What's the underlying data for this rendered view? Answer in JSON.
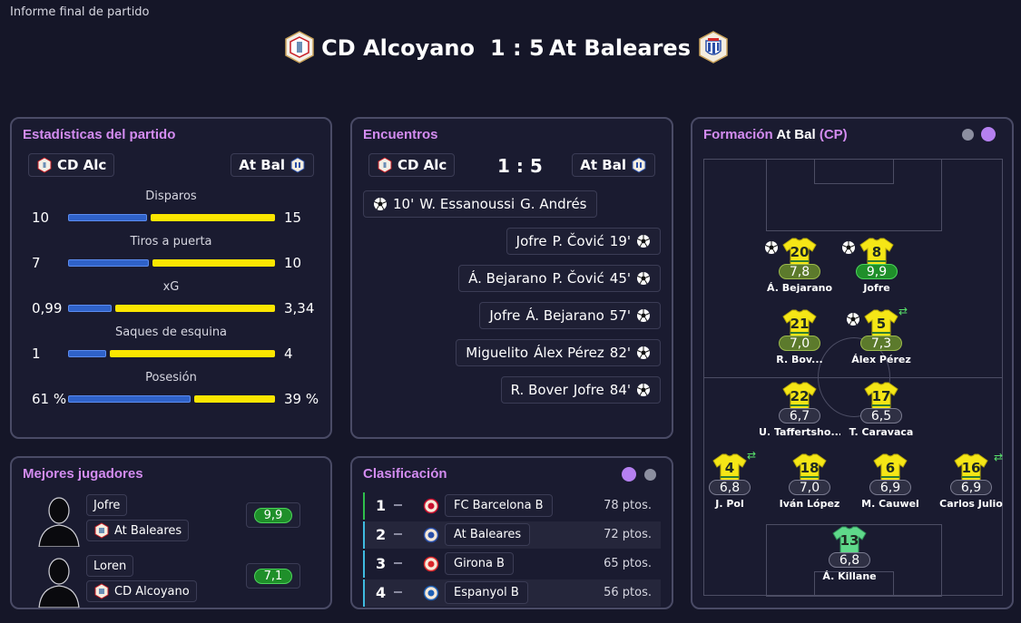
{
  "window": {
    "title": "Informe final de partido"
  },
  "match": {
    "home": "CD Alcoyano",
    "away": "At Baleares",
    "score": "1 : 5",
    "home_short": "CD Alc",
    "away_short": "At Bal"
  },
  "stats_panel": {
    "title": "Estadísticas del partido",
    "rows": [
      {
        "label": "Disparos",
        "home": "10",
        "away": "15",
        "home_frac": 0.4,
        "away_frac": 0.6
      },
      {
        "label": "Tiros a puerta",
        "home": "7",
        "away": "10",
        "home_frac": 0.41,
        "away_frac": 0.59
      },
      {
        "label": "xG",
        "home": "0,99",
        "away": "3,34",
        "home_frac": 0.23,
        "away_frac": 0.77
      },
      {
        "label": "Saques de esquina",
        "home": "1",
        "away": "4",
        "home_frac": 0.2,
        "away_frac": 0.8
      },
      {
        "label": "Posesión",
        "home": "61 %",
        "away": "39 %",
        "home_frac": 0.61,
        "away_frac": 0.39
      }
    ]
  },
  "events_panel": {
    "title": "Encuentros",
    "score": "1 : 5",
    "events": [
      {
        "side": "home",
        "minute": "10'",
        "scorer": "W. Essanoussi",
        "assist": "G. Andrés"
      },
      {
        "side": "away",
        "minute": "19'",
        "scorer": "P. Čović",
        "assist": "Jofre"
      },
      {
        "side": "away",
        "minute": "45'",
        "scorer": "P. Čović",
        "assist": "Á. Bejarano"
      },
      {
        "side": "away",
        "minute": "57'",
        "scorer": "Á. Bejarano",
        "assist": "Jofre"
      },
      {
        "side": "away",
        "minute": "82'",
        "scorer": "Álex Pérez",
        "assist": "Miguelito"
      },
      {
        "side": "away",
        "minute": "84'",
        "scorer": "Jofre",
        "assist": "R. Bover"
      }
    ]
  },
  "formation_panel": {
    "title_prefix": "Formación",
    "team": "At Bal",
    "suffix": "(CP)",
    "players": [
      {
        "num": "20",
        "rating": "7,8",
        "name": "Á. Bejarano",
        "tier": "good",
        "goal": true,
        "sub": false
      },
      {
        "num": "8",
        "rating": "9,9",
        "name": "Jofre",
        "tier": "great",
        "goal": true,
        "sub": false
      },
      {
        "num": "21",
        "rating": "7,0",
        "name": "R. Bov...",
        "tier": "good",
        "goal": false,
        "sub": false
      },
      {
        "num": "5",
        "rating": "7,3",
        "name": "Álex Pérez",
        "tier": "good",
        "goal": true,
        "sub": true
      },
      {
        "num": "22",
        "rating": "6,7",
        "name": "U. Taffertsho...",
        "tier": "neutral",
        "goal": false,
        "sub": false
      },
      {
        "num": "17",
        "rating": "6,5",
        "name": "T. Caravaca",
        "tier": "neutral",
        "goal": false,
        "sub": false
      },
      {
        "num": "4",
        "rating": "6,8",
        "name": "J. Pol",
        "tier": "neutral",
        "goal": false,
        "sub": true
      },
      {
        "num": "18",
        "rating": "7,0",
        "name": "Iván López",
        "tier": "neutral",
        "goal": false,
        "sub": false
      },
      {
        "num": "6",
        "rating": "6,9",
        "name": "M. Cauwel",
        "tier": "neutral",
        "goal": false,
        "sub": false
      },
      {
        "num": "16",
        "rating": "6,9",
        "name": "Carlos Julio",
        "tier": "neutral",
        "goal": false,
        "sub": true
      },
      {
        "num": "13",
        "rating": "6,8",
        "name": "Á. Killane",
        "tier": "neutral",
        "goal": false,
        "sub": false,
        "keeper": true
      }
    ]
  },
  "best_players_panel": {
    "title": "Mejores jugadores",
    "players": [
      {
        "name": "Jofre",
        "club": "At Baleares",
        "rating": "9,9"
      },
      {
        "name": "Loren",
        "club": "CD Alcoyano",
        "rating": "7,1"
      }
    ]
  },
  "standings_panel": {
    "title": "Clasificación",
    "rows": [
      {
        "pos": "1",
        "club": "FC Barcelona B",
        "pts": "78 ptos.",
        "accent": "#2fbf4c",
        "crest_color": "#c8102e"
      },
      {
        "pos": "2",
        "club": "At Baleares",
        "pts": "72 ptos.",
        "accent": "#3fbbe0",
        "crest_color": "#2a4fa8"
      },
      {
        "pos": "3",
        "club": "Girona B",
        "pts": "65 ptos.",
        "accent": "#3fbbe0",
        "crest_color": "#d9262a"
      },
      {
        "pos": "4",
        "club": "Espanyol B",
        "pts": "56 ptos.",
        "accent": "#3fbbe0",
        "crest_color": "#1e5fb4"
      }
    ]
  },
  "colors": {
    "accent": "#d38cf0",
    "home_bar": "#2f62c9",
    "away_bar": "#fbe600",
    "dot_active": "#b580f0",
    "dot_inactive": "#8c8fa0"
  }
}
